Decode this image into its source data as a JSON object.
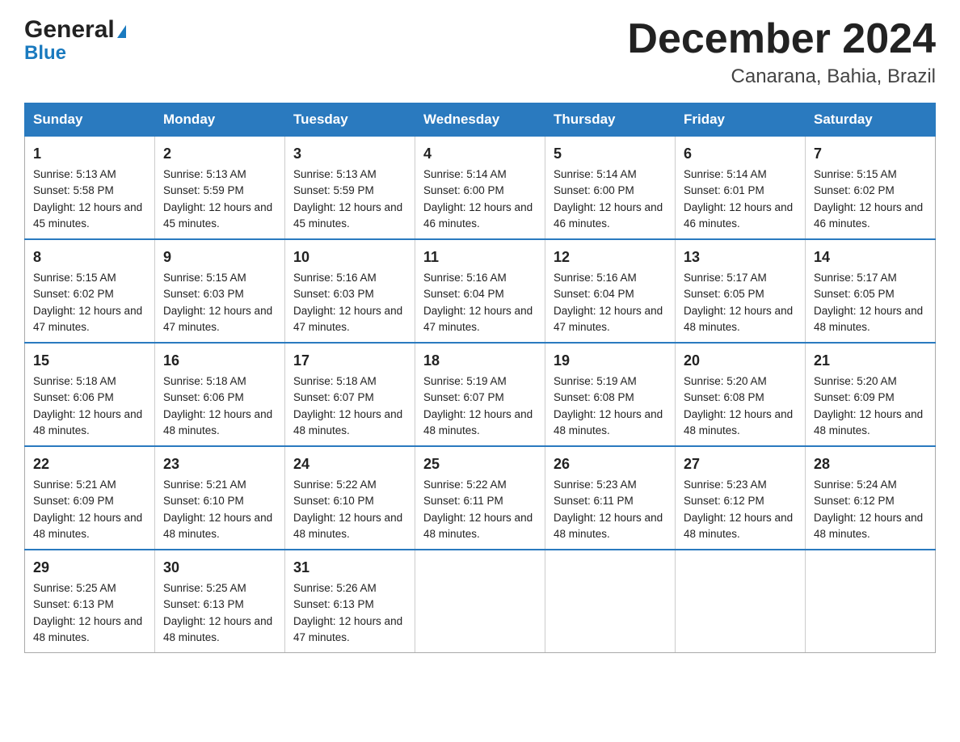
{
  "header": {
    "logo_general": "General",
    "logo_blue": "Blue",
    "title": "December 2024",
    "subtitle": "Canarana, Bahia, Brazil"
  },
  "calendar": {
    "days_of_week": [
      "Sunday",
      "Monday",
      "Tuesday",
      "Wednesday",
      "Thursday",
      "Friday",
      "Saturday"
    ],
    "weeks": [
      [
        {
          "day": "1",
          "sunrise": "Sunrise: 5:13 AM",
          "sunset": "Sunset: 5:58 PM",
          "daylight": "Daylight: 12 hours and 45 minutes."
        },
        {
          "day": "2",
          "sunrise": "Sunrise: 5:13 AM",
          "sunset": "Sunset: 5:59 PM",
          "daylight": "Daylight: 12 hours and 45 minutes."
        },
        {
          "day": "3",
          "sunrise": "Sunrise: 5:13 AM",
          "sunset": "Sunset: 5:59 PM",
          "daylight": "Daylight: 12 hours and 45 minutes."
        },
        {
          "day": "4",
          "sunrise": "Sunrise: 5:14 AM",
          "sunset": "Sunset: 6:00 PM",
          "daylight": "Daylight: 12 hours and 46 minutes."
        },
        {
          "day": "5",
          "sunrise": "Sunrise: 5:14 AM",
          "sunset": "Sunset: 6:00 PM",
          "daylight": "Daylight: 12 hours and 46 minutes."
        },
        {
          "day": "6",
          "sunrise": "Sunrise: 5:14 AM",
          "sunset": "Sunset: 6:01 PM",
          "daylight": "Daylight: 12 hours and 46 minutes."
        },
        {
          "day": "7",
          "sunrise": "Sunrise: 5:15 AM",
          "sunset": "Sunset: 6:02 PM",
          "daylight": "Daylight: 12 hours and 46 minutes."
        }
      ],
      [
        {
          "day": "8",
          "sunrise": "Sunrise: 5:15 AM",
          "sunset": "Sunset: 6:02 PM",
          "daylight": "Daylight: 12 hours and 47 minutes."
        },
        {
          "day": "9",
          "sunrise": "Sunrise: 5:15 AM",
          "sunset": "Sunset: 6:03 PM",
          "daylight": "Daylight: 12 hours and 47 minutes."
        },
        {
          "day": "10",
          "sunrise": "Sunrise: 5:16 AM",
          "sunset": "Sunset: 6:03 PM",
          "daylight": "Daylight: 12 hours and 47 minutes."
        },
        {
          "day": "11",
          "sunrise": "Sunrise: 5:16 AM",
          "sunset": "Sunset: 6:04 PM",
          "daylight": "Daylight: 12 hours and 47 minutes."
        },
        {
          "day": "12",
          "sunrise": "Sunrise: 5:16 AM",
          "sunset": "Sunset: 6:04 PM",
          "daylight": "Daylight: 12 hours and 47 minutes."
        },
        {
          "day": "13",
          "sunrise": "Sunrise: 5:17 AM",
          "sunset": "Sunset: 6:05 PM",
          "daylight": "Daylight: 12 hours and 48 minutes."
        },
        {
          "day": "14",
          "sunrise": "Sunrise: 5:17 AM",
          "sunset": "Sunset: 6:05 PM",
          "daylight": "Daylight: 12 hours and 48 minutes."
        }
      ],
      [
        {
          "day": "15",
          "sunrise": "Sunrise: 5:18 AM",
          "sunset": "Sunset: 6:06 PM",
          "daylight": "Daylight: 12 hours and 48 minutes."
        },
        {
          "day": "16",
          "sunrise": "Sunrise: 5:18 AM",
          "sunset": "Sunset: 6:06 PM",
          "daylight": "Daylight: 12 hours and 48 minutes."
        },
        {
          "day": "17",
          "sunrise": "Sunrise: 5:18 AM",
          "sunset": "Sunset: 6:07 PM",
          "daylight": "Daylight: 12 hours and 48 minutes."
        },
        {
          "day": "18",
          "sunrise": "Sunrise: 5:19 AM",
          "sunset": "Sunset: 6:07 PM",
          "daylight": "Daylight: 12 hours and 48 minutes."
        },
        {
          "day": "19",
          "sunrise": "Sunrise: 5:19 AM",
          "sunset": "Sunset: 6:08 PM",
          "daylight": "Daylight: 12 hours and 48 minutes."
        },
        {
          "day": "20",
          "sunrise": "Sunrise: 5:20 AM",
          "sunset": "Sunset: 6:08 PM",
          "daylight": "Daylight: 12 hours and 48 minutes."
        },
        {
          "day": "21",
          "sunrise": "Sunrise: 5:20 AM",
          "sunset": "Sunset: 6:09 PM",
          "daylight": "Daylight: 12 hours and 48 minutes."
        }
      ],
      [
        {
          "day": "22",
          "sunrise": "Sunrise: 5:21 AM",
          "sunset": "Sunset: 6:09 PM",
          "daylight": "Daylight: 12 hours and 48 minutes."
        },
        {
          "day": "23",
          "sunrise": "Sunrise: 5:21 AM",
          "sunset": "Sunset: 6:10 PM",
          "daylight": "Daylight: 12 hours and 48 minutes."
        },
        {
          "day": "24",
          "sunrise": "Sunrise: 5:22 AM",
          "sunset": "Sunset: 6:10 PM",
          "daylight": "Daylight: 12 hours and 48 minutes."
        },
        {
          "day": "25",
          "sunrise": "Sunrise: 5:22 AM",
          "sunset": "Sunset: 6:11 PM",
          "daylight": "Daylight: 12 hours and 48 minutes."
        },
        {
          "day": "26",
          "sunrise": "Sunrise: 5:23 AM",
          "sunset": "Sunset: 6:11 PM",
          "daylight": "Daylight: 12 hours and 48 minutes."
        },
        {
          "day": "27",
          "sunrise": "Sunrise: 5:23 AM",
          "sunset": "Sunset: 6:12 PM",
          "daylight": "Daylight: 12 hours and 48 minutes."
        },
        {
          "day": "28",
          "sunrise": "Sunrise: 5:24 AM",
          "sunset": "Sunset: 6:12 PM",
          "daylight": "Daylight: 12 hours and 48 minutes."
        }
      ],
      [
        {
          "day": "29",
          "sunrise": "Sunrise: 5:25 AM",
          "sunset": "Sunset: 6:13 PM",
          "daylight": "Daylight: 12 hours and 48 minutes."
        },
        {
          "day": "30",
          "sunrise": "Sunrise: 5:25 AM",
          "sunset": "Sunset: 6:13 PM",
          "daylight": "Daylight: 12 hours and 48 minutes."
        },
        {
          "day": "31",
          "sunrise": "Sunrise: 5:26 AM",
          "sunset": "Sunset: 6:13 PM",
          "daylight": "Daylight: 12 hours and 47 minutes."
        },
        {
          "day": "",
          "sunrise": "",
          "sunset": "",
          "daylight": ""
        },
        {
          "day": "",
          "sunrise": "",
          "sunset": "",
          "daylight": ""
        },
        {
          "day": "",
          "sunrise": "",
          "sunset": "",
          "daylight": ""
        },
        {
          "day": "",
          "sunrise": "",
          "sunset": "",
          "daylight": ""
        }
      ]
    ]
  }
}
